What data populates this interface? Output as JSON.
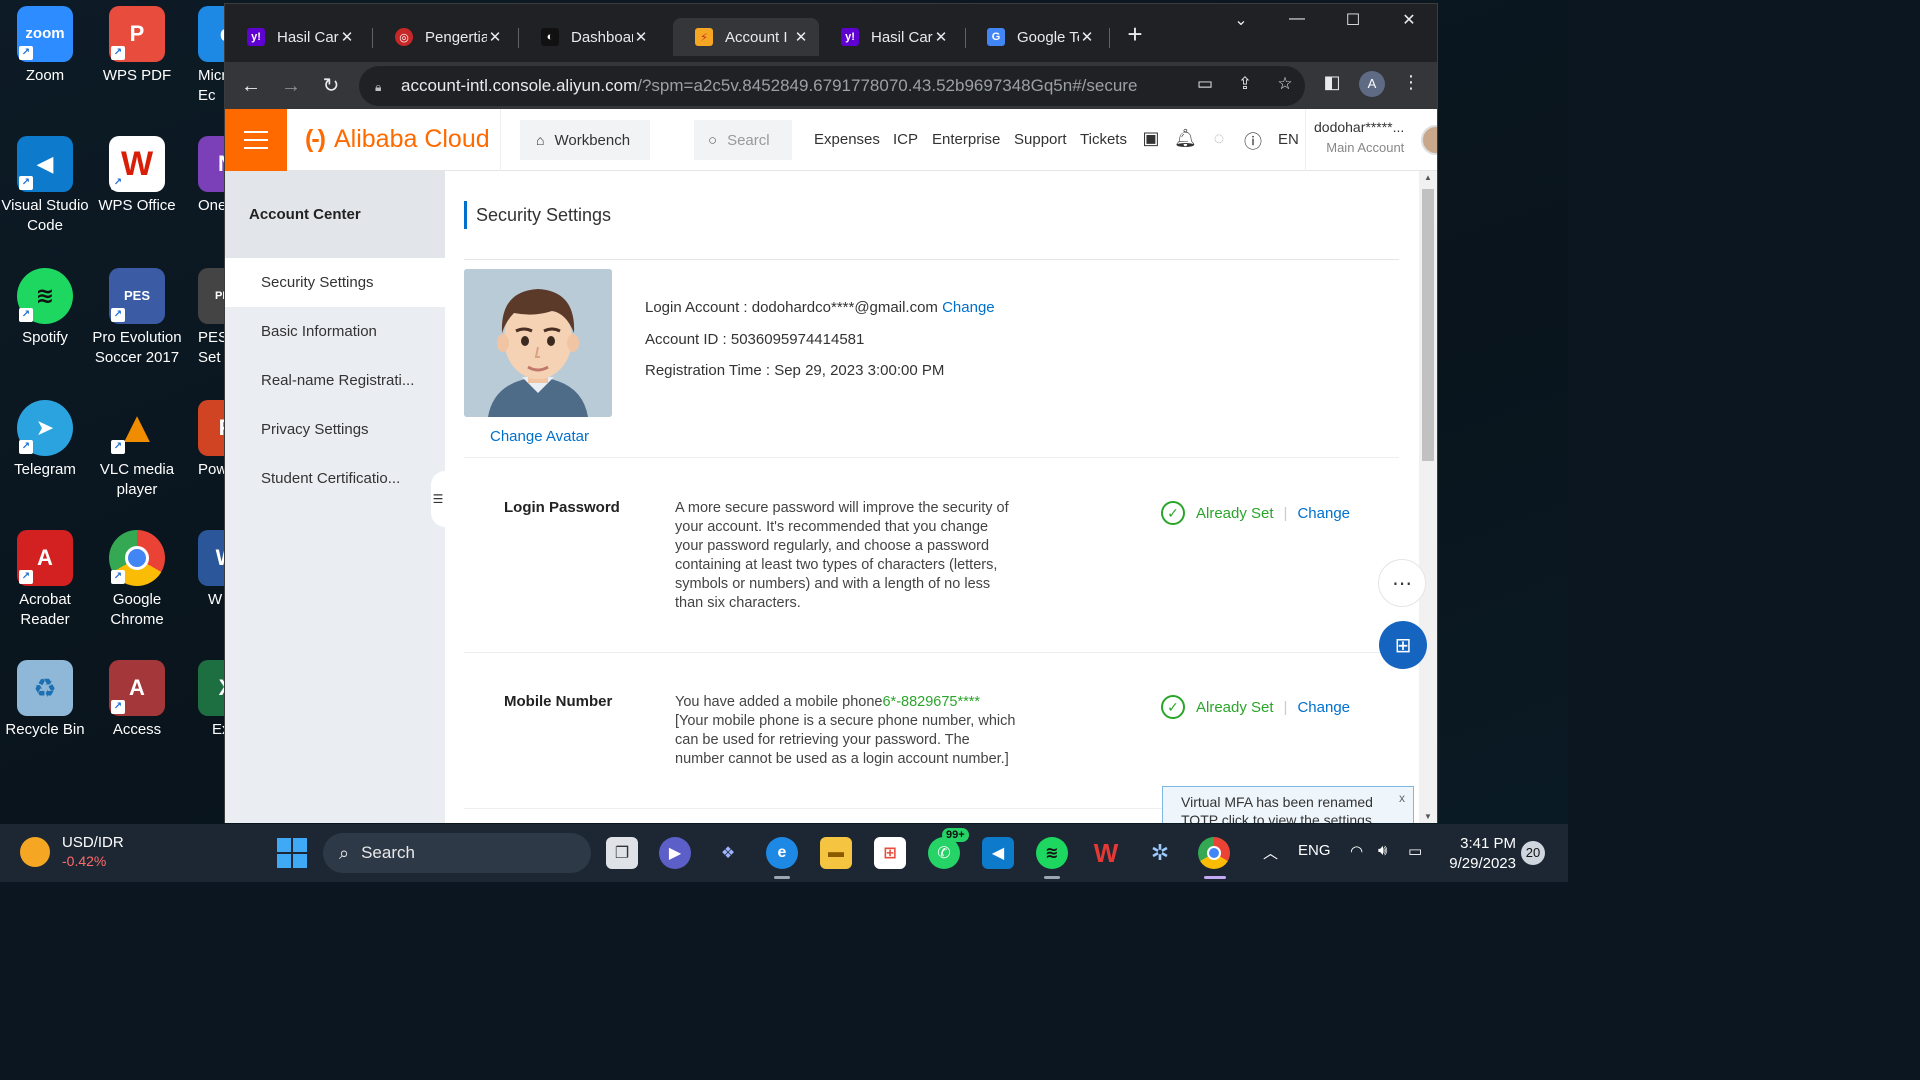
{
  "desktop": {
    "icons": [
      {
        "label": "Zoom",
        "icon": "zoom-icon",
        "color": "#2d8cff",
        "glyph": "zoom"
      },
      {
        "label": "WPS PDF",
        "icon": "wps-pdf-icon",
        "color": "#e84c3d",
        "glyph": "P"
      },
      {
        "label": "Micr Ec",
        "icon": "edge-icon",
        "color": "#1e88e5",
        "glyph": "e"
      },
      {
        "label": "Visual Studio Code",
        "icon": "vscode-icon",
        "color": "#0d7acc",
        "glyph": "◀"
      },
      {
        "label": "WPS Office",
        "icon": "wps-office-icon",
        "color": "#ffffff",
        "glyph": "W"
      },
      {
        "label": "One",
        "icon": "onenote-icon",
        "color": "#7b3fb8",
        "glyph": "N"
      },
      {
        "label": "Spotify",
        "icon": "spotify-icon",
        "color": "#1ed760",
        "glyph": "≋"
      },
      {
        "label": "Pro Evolution Soccer 2017",
        "icon": "pes-icon",
        "color": "#3b5ba5",
        "glyph": "PES"
      },
      {
        "label": "PES Set",
        "icon": "pes-settings-icon",
        "color": "#444444",
        "glyph": "PES"
      },
      {
        "label": "Telegram",
        "icon": "telegram-icon",
        "color": "#2aa3df",
        "glyph": "➤"
      },
      {
        "label": "VLC media player",
        "icon": "vlc-icon",
        "color": "#f08c00",
        "glyph": "▲"
      },
      {
        "label": "Powe",
        "icon": "powerpoint-icon",
        "color": "#d04423",
        "glyph": "P"
      },
      {
        "label": "Acrobat Reader",
        "icon": "acrobat-icon",
        "color": "#d32020",
        "glyph": "A"
      },
      {
        "label": "Google Chrome",
        "icon": "chrome-icon",
        "color": "#4285f4",
        "glyph": "●"
      },
      {
        "label": "W",
        "icon": "word-icon",
        "color": "#2b579a",
        "glyph": "W"
      },
      {
        "label": "Recycle Bin",
        "icon": "recycle-bin-icon",
        "color": "#8fb8d8",
        "glyph": "♻"
      },
      {
        "label": "Access",
        "icon": "access-icon",
        "color": "#a4373a",
        "glyph": "A"
      },
      {
        "label": "Ex",
        "icon": "excel-icon",
        "color": "#1d6f42",
        "glyph": "X"
      }
    ]
  },
  "browser": {
    "tabs": [
      {
        "title": "Hasil Cari",
        "icon": "yahoo-icon",
        "color": "#5f01d1",
        "glyph": "y!"
      },
      {
        "title": "Pengertia",
        "icon": "site-icon",
        "color": "#c62828",
        "glyph": "◎"
      },
      {
        "title": "Dashboar",
        "icon": "dashboard-icon",
        "color": "#111111",
        "glyph": "◐"
      },
      {
        "title": "Account I",
        "icon": "alibaba-icon",
        "color": "#f5a623",
        "glyph": "⚡"
      },
      {
        "title": "Hasil Cari",
        "icon": "yahoo-icon",
        "color": "#5f01d1",
        "glyph": "y!"
      },
      {
        "title": "Google Te",
        "icon": "google-translate-icon",
        "color": "#4285f4",
        "glyph": "G"
      }
    ],
    "url_host": "account-intl.console.aliyun.com",
    "url_rest": "/?spm=a2c5v.8452849.6791778070.43.52b9697348Gq5n#/secure",
    "profile_initial": "A"
  },
  "console": {
    "brand": "Alibaba Cloud",
    "brand_logo": "(-)",
    "workbench": "Workbench",
    "search_placeholder": "Searcl",
    "nav_links": [
      "Expenses",
      "ICP",
      "Enterprise",
      "Support",
      "Tickets"
    ],
    "lang": "EN",
    "account_name": "dodohar*****...",
    "account_type": "Main Account"
  },
  "sidebar": {
    "title": "Account Center",
    "items": [
      "Security Settings",
      "Basic Information",
      "Real-name Registrati...",
      "Privacy Settings",
      "Student Certificatio..."
    ]
  },
  "main": {
    "title": "Security Settings",
    "change_avatar": "Change Avatar",
    "login_account_label": "Login Account : dodohardco****@gmail.com",
    "login_account_change": "Change",
    "account_id": "Account ID : 5036095974414581",
    "registration_time": "Registration Time : Sep 29, 2023 3:00:00 PM",
    "rows": [
      {
        "label": "Login Password",
        "desc": "A more secure password will improve the security of your account. It's recommended that you change your password regularly, and choose a password containing at least two types of characters (letters, symbols or numbers) and with a length of no less than six characters.",
        "status": "Already Set",
        "action": "Change"
      },
      {
        "label": "Mobile Number",
        "desc_prefix": "You have added a mobile phone",
        "phone": "6*-8829675****",
        "desc_suffix": "[Your mobile phone is a secure phone number, which can be used for retrieving your password. The number cannot be used as a login account number.]",
        "status": "Already Set",
        "action": "Change"
      }
    ],
    "toast": "Virtual MFA has been renamed TOTP click to view the settings",
    "toast_close": "x"
  },
  "taskbar": {
    "ticker_name": "USD/IDR",
    "ticker_change": "-0.42%",
    "search": "Search",
    "whatsapp_badge": "99+",
    "lang": "ENG",
    "time": "3:41 PM",
    "date": "9/29/2023",
    "notifications": "20"
  },
  "colors": {
    "brand_orange": "#ff6a00",
    "link_blue": "#0070cc",
    "ok_green": "#2aa52a"
  }
}
